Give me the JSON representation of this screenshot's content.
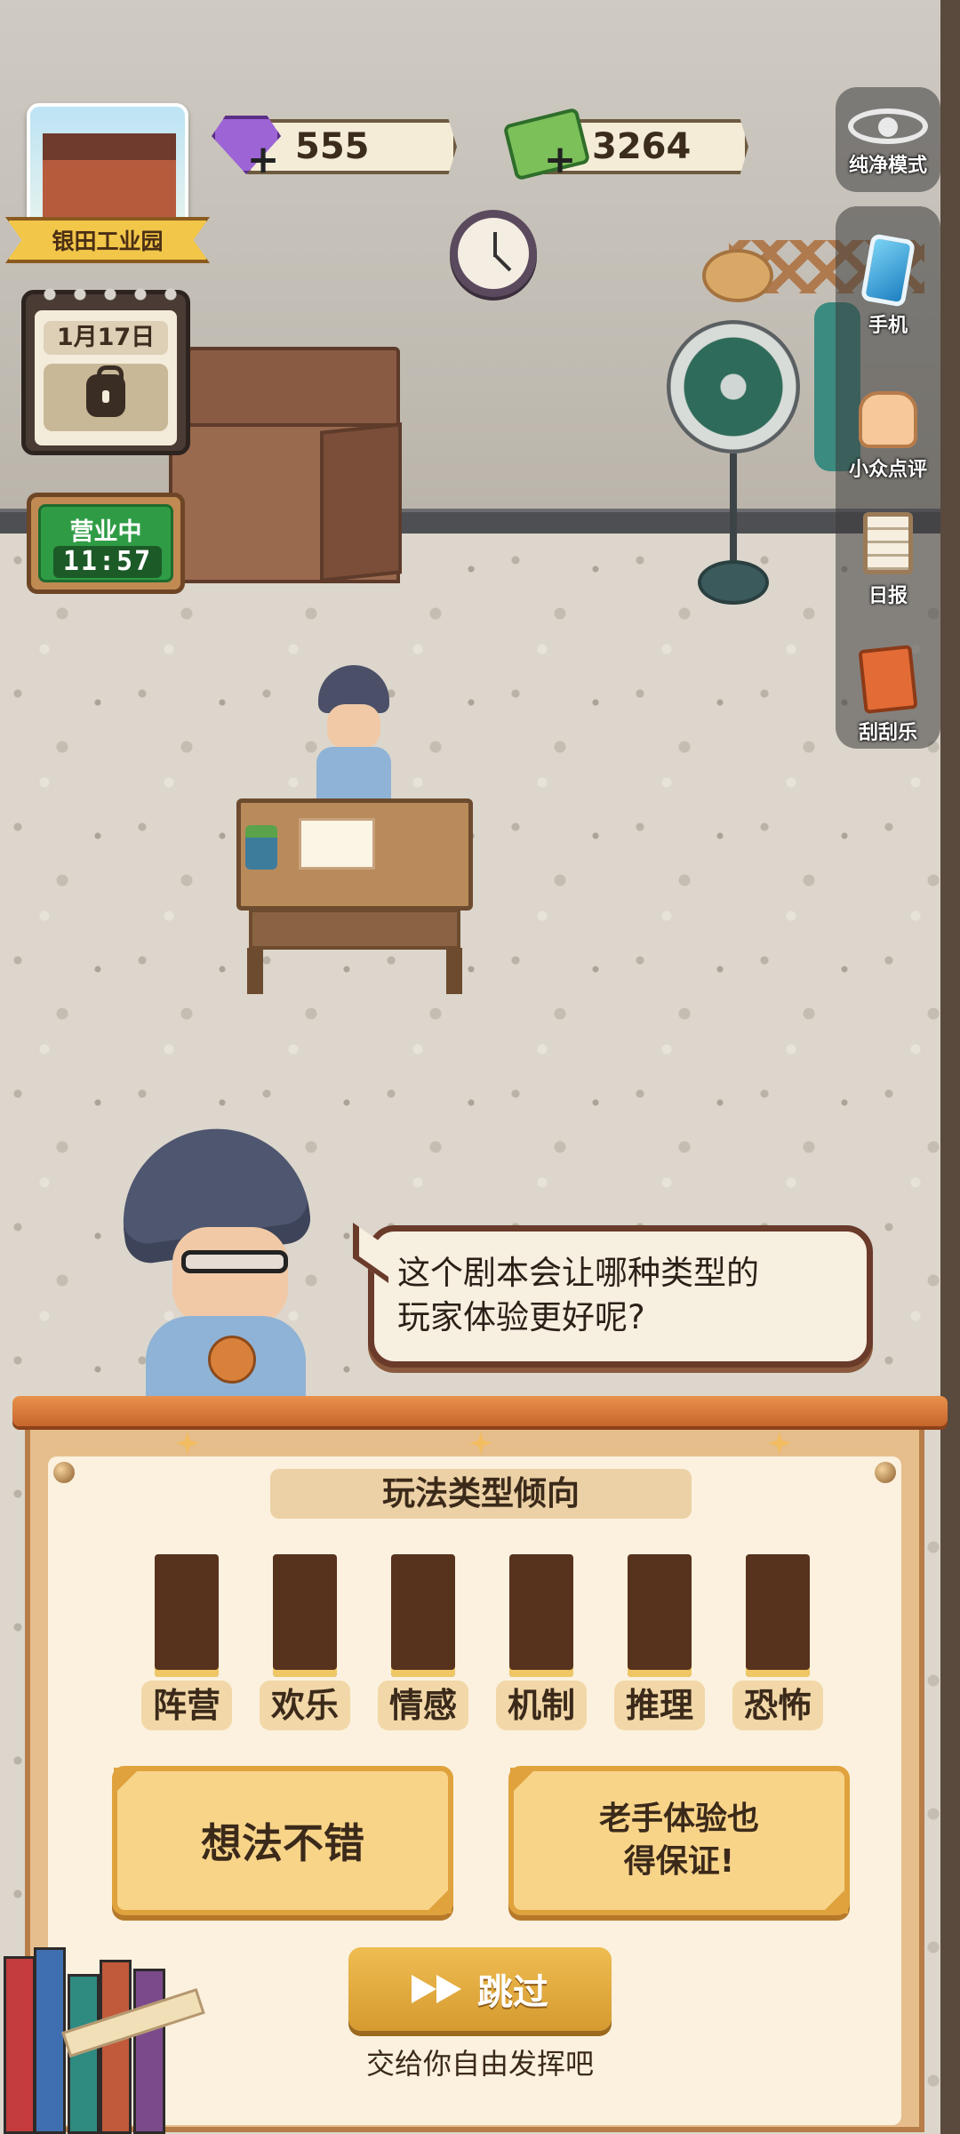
{
  "hud": {
    "location_name": "银田工业园",
    "gems": "555",
    "cash": "3264",
    "date": "1月17日",
    "open_status": "营业中",
    "time": "11:57"
  },
  "right_rail": [
    {
      "label": "纯净模式",
      "icon": "eye-icon"
    },
    {
      "label": "手机",
      "icon": "phone-icon"
    },
    {
      "label": "小众点评",
      "icon": "thumbs-up-icon"
    },
    {
      "label": "日报",
      "icon": "clipboard-icon"
    },
    {
      "label": "刮刮乐",
      "icon": "scratch-card-icon"
    }
  ],
  "dialogue": {
    "text_line1": "这个剧本会让哪种类型的",
    "text_line2": "玩家体验更好呢?"
  },
  "panel": {
    "title": "玩法类型倾向",
    "categories": [
      "阵营",
      "欢乐",
      "情感",
      "机制",
      "推理",
      "恐怖"
    ],
    "choice_left": "想法不错",
    "choice_right_line1": "老手体验也",
    "choice_right_line2": "得保证!",
    "skip_label": "跳过",
    "skip_hint": "交给你自由发挥吧"
  },
  "colors": {
    "panel_bg": "#fbf1de",
    "choice_fill": "#f8d489",
    "bar_dark": "#57321d",
    "open_green": "#2f9c45"
  }
}
